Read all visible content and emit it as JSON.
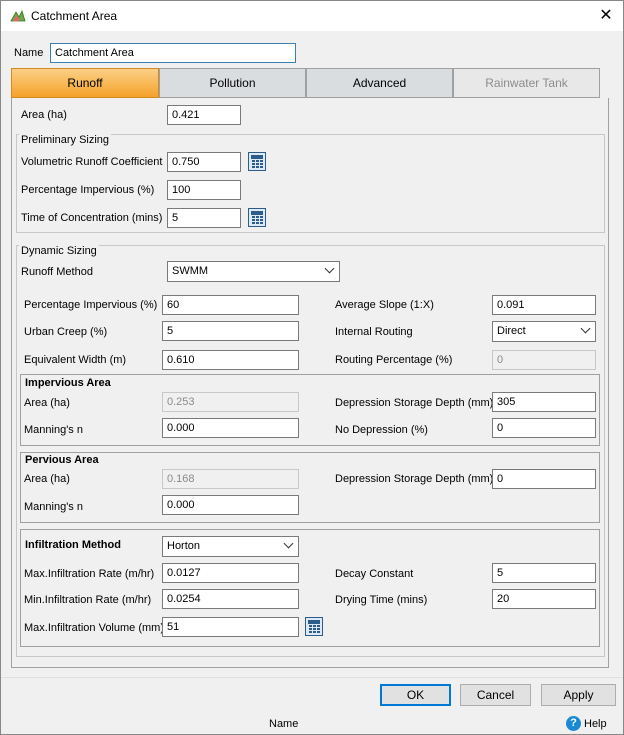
{
  "window": {
    "title": "Catchment Area",
    "close_icon": "close-icon"
  },
  "name_field": {
    "label": "Name",
    "value": "Catchment Area"
  },
  "tabs": [
    {
      "label": "Runoff",
      "state": "active"
    },
    {
      "label": "Pollution",
      "state": "normal"
    },
    {
      "label": "Advanced",
      "state": "normal"
    },
    {
      "label": "Rainwater Tank",
      "state": "disabled"
    }
  ],
  "area": {
    "label": "Area (ha)",
    "value": "0.421"
  },
  "preliminary": {
    "legend": "Preliminary Sizing",
    "runoff_coeff": {
      "label": "Volumetric Runoff Coefficient",
      "value": "0.750"
    },
    "pct_impervious": {
      "label": "Percentage Impervious (%)",
      "value": "100"
    },
    "time_conc": {
      "label": "Time of Concentration (mins)",
      "value": "5"
    }
  },
  "dynamic": {
    "legend": "Dynamic Sizing",
    "runoff_method": {
      "label": "Runoff Method",
      "value": "SWMM"
    },
    "pct_impervious": {
      "label": "Percentage Impervious (%)",
      "value": "60"
    },
    "urban_creep": {
      "label": "Urban Creep (%)",
      "value": "5"
    },
    "equiv_width": {
      "label": "Equivalent Width (m)",
      "value": "0.610"
    },
    "avg_slope": {
      "label": "Average Slope (1:X)",
      "value": "0.091"
    },
    "internal_routing": {
      "label": "Internal Routing",
      "value": "Direct"
    },
    "routing_pct": {
      "label": "Routing Percentage (%)",
      "value": "0"
    }
  },
  "impervious": {
    "title": "Impervious Area",
    "area": {
      "label": "Area (ha)",
      "value": "0.253"
    },
    "mannings": {
      "label": "Manning's n",
      "value": "0.000"
    },
    "dep_depth": {
      "label": "Depression Storage Depth (mm)",
      "value": "305"
    },
    "no_dep": {
      "label": "No Depression (%)",
      "value": "0"
    }
  },
  "pervious": {
    "title": "Pervious Area",
    "area": {
      "label": "Area (ha)",
      "value": "0.168"
    },
    "mannings": {
      "label": "Manning's n",
      "value": "0.000"
    },
    "dep_depth": {
      "label": "Depression Storage Depth (mm)",
      "value": "0"
    }
  },
  "infiltration": {
    "title": "Infiltration Method",
    "method": "Horton",
    "max_rate": {
      "label": "Max.Infiltration Rate (m/hr)",
      "value": "0.0127"
    },
    "min_rate": {
      "label": "Min.Infiltration Rate (m/hr)",
      "value": "0.0254"
    },
    "max_volume": {
      "label": "Max.Infiltration Volume (mm)",
      "value": "51"
    },
    "decay": {
      "label": "Decay Constant",
      "value": "5"
    },
    "drying": {
      "label": "Drying Time (mins)",
      "value": "20"
    }
  },
  "buttons": {
    "ok": "OK",
    "cancel": "Cancel",
    "apply": "Apply"
  },
  "status": {
    "text": "Name",
    "help": "Help",
    "help_icon": "?"
  },
  "colors": {
    "active_tab": "#f5a229",
    "accent": "#0078d7"
  }
}
